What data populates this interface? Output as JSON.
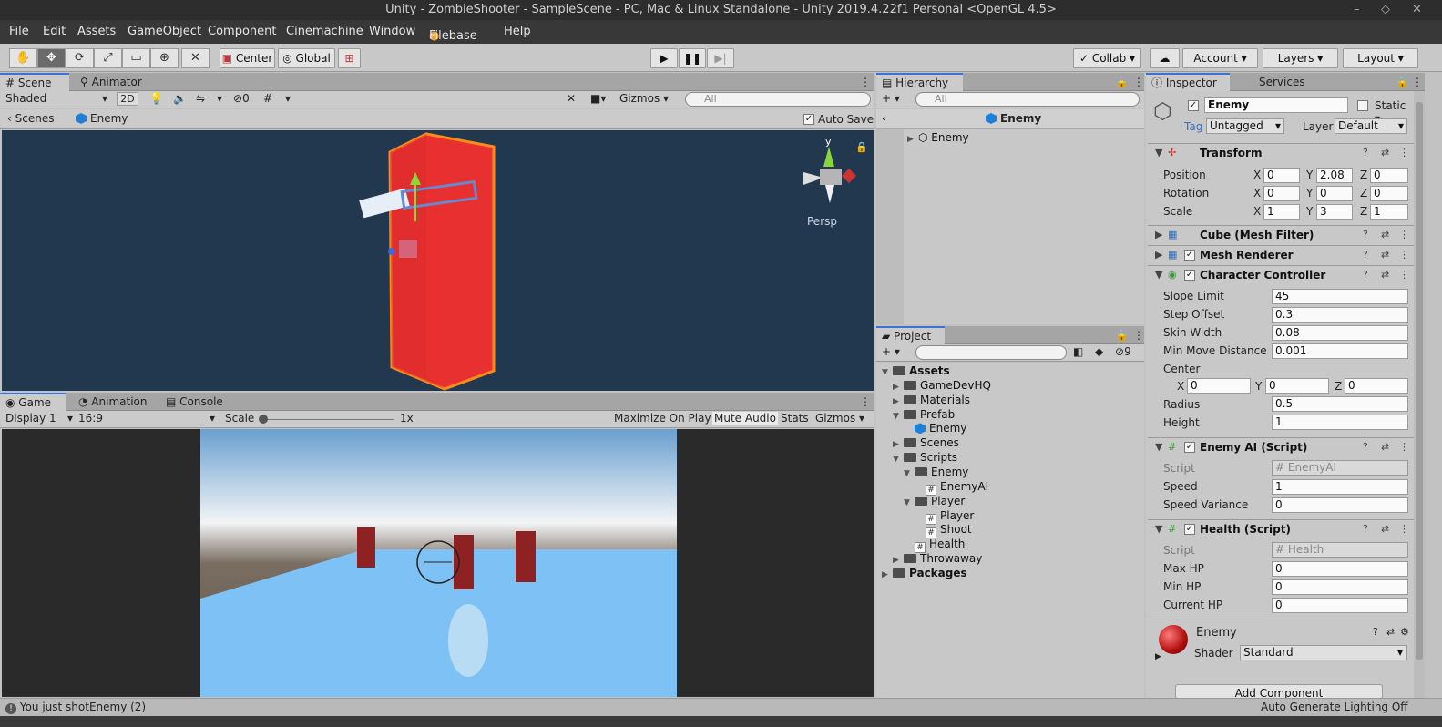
{
  "window": {
    "title": "Unity - ZombieShooter - SampleScene - PC, Mac & Linux Standalone - Unity 2019.4.22f1 Personal <OpenGL 4.5>"
  },
  "menu": [
    "File",
    "Edit",
    "Assets",
    "GameObject",
    "Component",
    "Cinemachine",
    "Window",
    "Filebase",
    "Help"
  ],
  "toolbar": {
    "center": "Center",
    "global": "Global",
    "collab": "Collab",
    "account": "Account",
    "layers": "Layers",
    "layout": "Layout"
  },
  "scene": {
    "tabs": [
      "Scene",
      "Animator"
    ],
    "shading": "Shaded",
    "mode2d": "2D",
    "hidden_count": "0",
    "gizmos": "Gizmos",
    "search_placeholder": "All",
    "breadcrumb_root": "Scenes",
    "breadcrumb_item": "Enemy",
    "autosave": "Auto Save",
    "persp": "Persp",
    "axis_y": "y"
  },
  "game": {
    "tabs": [
      "Game",
      "Animation",
      "Console"
    ],
    "display": "Display 1",
    "aspect": "16:9",
    "scale_label": "Scale",
    "scale_value": "1x",
    "maximize": "Maximize On Play",
    "mute": "Mute Audio",
    "stats": "Stats",
    "gizmos": "Gizmos"
  },
  "hierarchy": {
    "title": "Hierarchy",
    "search_placeholder": "All",
    "header": "Enemy",
    "items": [
      "Enemy"
    ]
  },
  "project": {
    "title": "Project",
    "hidden_count": "9",
    "tree": [
      {
        "label": "Assets",
        "type": "folder",
        "depth": 0,
        "bold": true,
        "open": true
      },
      {
        "label": "GameDevHQ",
        "type": "folder",
        "depth": 1
      },
      {
        "label": "Materials",
        "type": "folder",
        "depth": 1
      },
      {
        "label": "Prefab",
        "type": "folder",
        "depth": 1,
        "open": true
      },
      {
        "label": "Enemy",
        "type": "prefab",
        "depth": 2
      },
      {
        "label": "Scenes",
        "type": "folder",
        "depth": 1
      },
      {
        "label": "Scripts",
        "type": "folder",
        "depth": 1,
        "open": true
      },
      {
        "label": "Enemy",
        "type": "folder",
        "depth": 2,
        "open": true
      },
      {
        "label": "EnemyAI",
        "type": "script",
        "depth": 3
      },
      {
        "label": "Player",
        "type": "folder",
        "depth": 2,
        "open": true
      },
      {
        "label": "Player",
        "type": "script",
        "depth": 3
      },
      {
        "label": "Shoot",
        "type": "script",
        "depth": 3
      },
      {
        "label": "Health",
        "type": "script",
        "depth": 2
      },
      {
        "label": "Throwaway",
        "type": "folder",
        "depth": 1
      },
      {
        "label": "Packages",
        "type": "folder",
        "depth": 0,
        "bold": true
      }
    ]
  },
  "inspector": {
    "tabs": [
      "Inspector",
      "Services"
    ],
    "object_name": "Enemy",
    "static_label": "Static",
    "tag_label": "Tag",
    "tag_value": "Untagged",
    "layer_label": "Layer",
    "layer_value": "Default",
    "transform": {
      "title": "Transform",
      "rows": [
        {
          "label": "Position",
          "x": "0",
          "y": "2.08",
          "z": "0"
        },
        {
          "label": "Rotation",
          "x": "0",
          "y": "0",
          "z": "0"
        },
        {
          "label": "Scale",
          "x": "1",
          "y": "3",
          "z": "1"
        }
      ]
    },
    "mesh_filter": "Cube (Mesh Filter)",
    "mesh_renderer": "Mesh Renderer",
    "character_controller": {
      "title": "Character Controller",
      "fields": [
        {
          "label": "Slope Limit",
          "value": "45"
        },
        {
          "label": "Step Offset",
          "value": "0.3"
        },
        {
          "label": "Skin Width",
          "value": "0.08"
        },
        {
          "label": "Min Move Distance",
          "value": "0.001"
        }
      ],
      "center_label": "Center",
      "center": {
        "x": "0",
        "y": "0",
        "z": "0"
      },
      "radius_label": "Radius",
      "radius": "0.5",
      "height_label": "Height",
      "height": "1"
    },
    "enemy_ai": {
      "title": "Enemy AI (Script)",
      "script_label": "Script",
      "script": "EnemyAI",
      "fields": [
        {
          "label": "Speed",
          "value": "1"
        },
        {
          "label": "Speed Variance",
          "value": "0"
        }
      ]
    },
    "health": {
      "title": "Health (Script)",
      "script_label": "Script",
      "script": "Health",
      "fields": [
        {
          "label": "Max HP",
          "value": "0"
        },
        {
          "label": "Min HP",
          "value": "0"
        },
        {
          "label": "Current HP",
          "value": "0"
        }
      ]
    },
    "material": {
      "name": "Enemy",
      "shader_label": "Shader",
      "shader": "Standard"
    },
    "add_component": "Add Component"
  },
  "status": {
    "message": "You just shotEnemy (2)",
    "lighting": "Auto Generate Lighting Off"
  },
  "axes": {
    "x": "X",
    "y": "Y",
    "z": "Z"
  },
  "colors": {
    "scene_bg": "#21384f",
    "selection": "#e83030",
    "accent": "#3a72d6"
  }
}
